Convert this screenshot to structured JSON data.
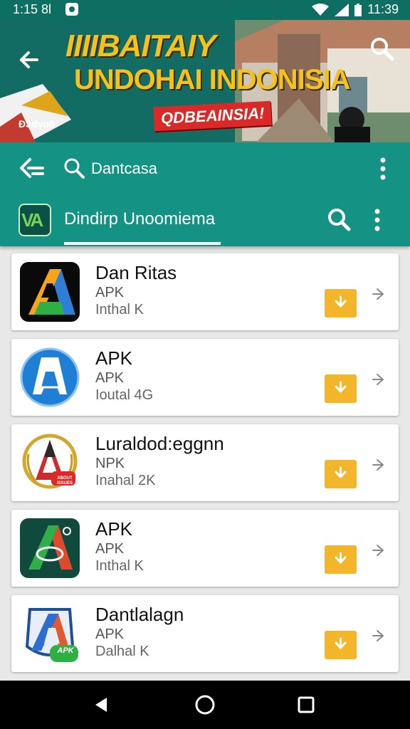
{
  "status": {
    "time_left": "1:15 8l",
    "time_right": "11:39"
  },
  "banner": {
    "title_line1": "IIIIBAITAIY",
    "title_line2": "UNDOHAI INDONISIA",
    "badge": "QDBEAINSIA!",
    "small_text": "Ð3dvo8"
  },
  "toolbar": {
    "query": "Dantcasa"
  },
  "app_header": {
    "logo_text": "VA",
    "title": "Dindirp Unoomiema"
  },
  "apps": [
    {
      "name": "Dan Ritas",
      "type": "APK",
      "meta": "Inthal K"
    },
    {
      "name": "APK",
      "type": "APK",
      "meta": "Ioutal 4G"
    },
    {
      "name": "Luraldod:eggnn",
      "type": "NPK",
      "meta": "Inahal 2K"
    },
    {
      "name": "APK",
      "type": "APK",
      "meta": "Inthal K"
    },
    {
      "name": "Dantlalagn",
      "type": "APK",
      "meta": "Dalhal K"
    }
  ],
  "icons": {
    "app3_sticker": "ABOUT ISSUES",
    "app5_sticker": "APK"
  },
  "colors": {
    "primary": "#149284",
    "accent": "#f3b52a",
    "badge": "#d92a28"
  }
}
